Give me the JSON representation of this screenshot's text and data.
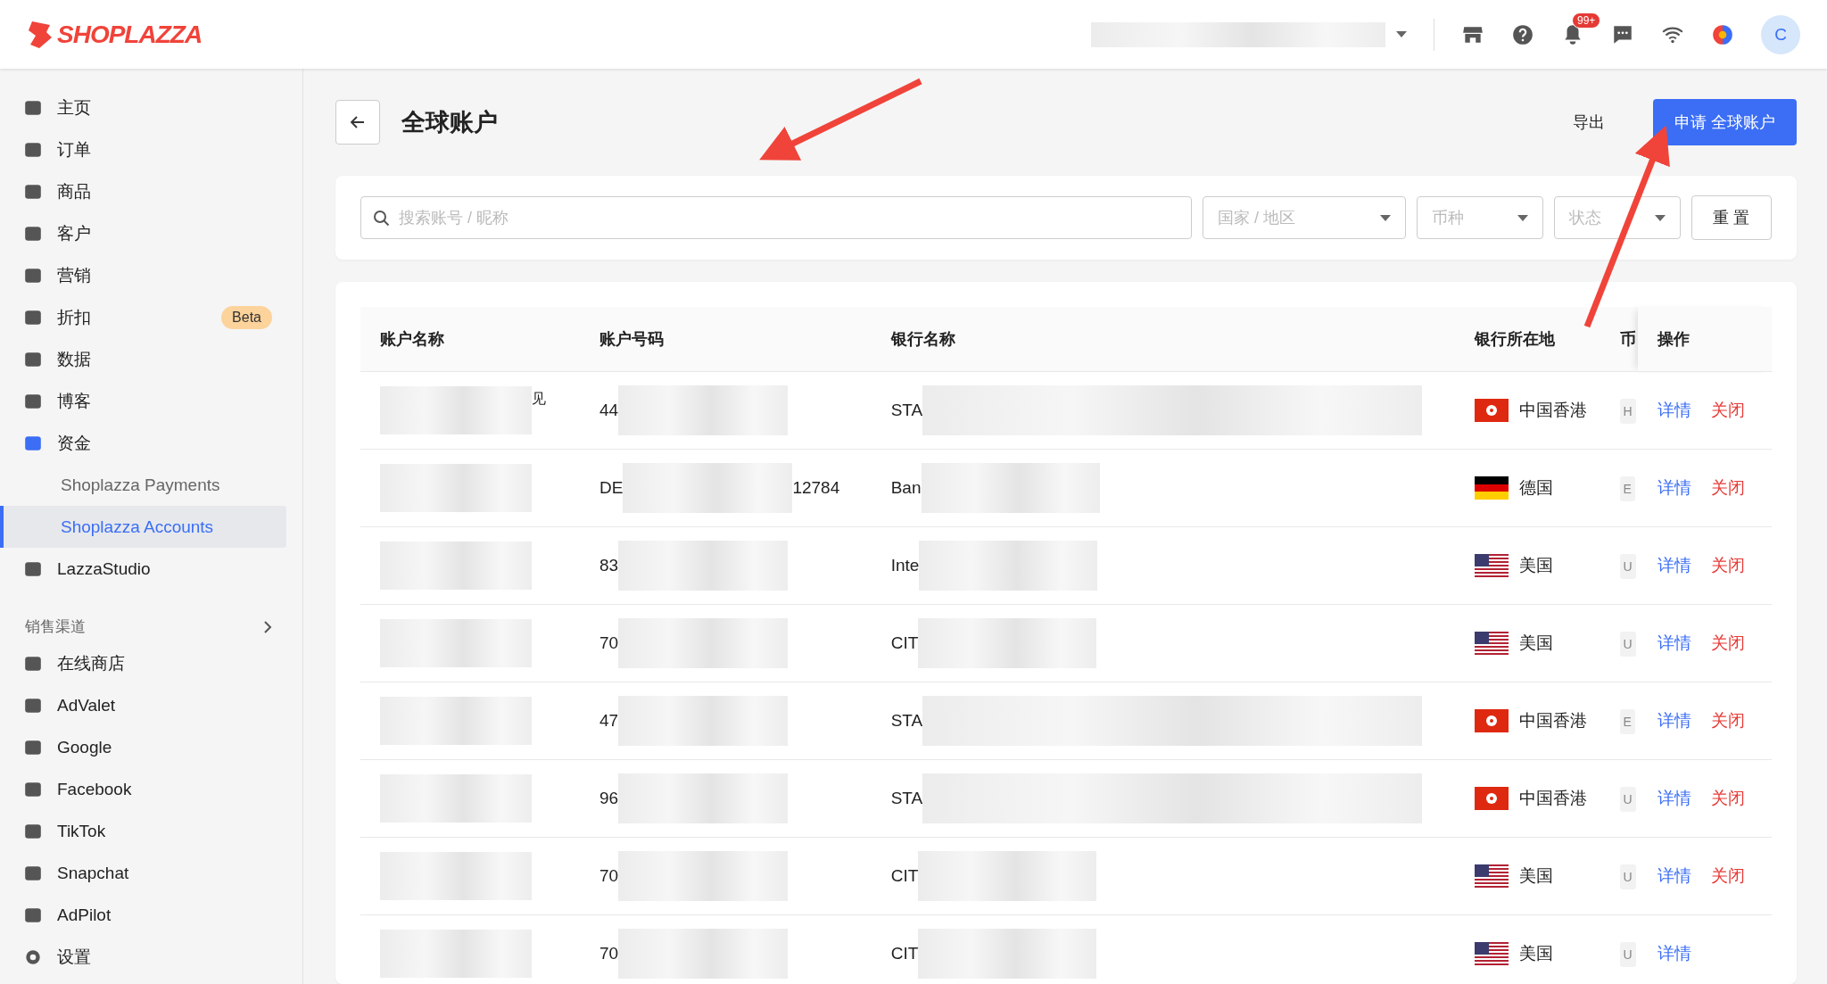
{
  "header": {
    "logo": "SHOPLAZZA",
    "notification_badge": "99+",
    "avatar": "C"
  },
  "sidebar": {
    "items": [
      {
        "label": "主页",
        "selected": false
      },
      {
        "label": "订单",
        "selected": false
      },
      {
        "label": "商品",
        "selected": false
      },
      {
        "label": "客户",
        "selected": false
      },
      {
        "label": "营销",
        "selected": false
      },
      {
        "label": "折扣",
        "selected": false,
        "badge": "Beta"
      },
      {
        "label": "数据",
        "selected": false
      },
      {
        "label": "博客",
        "selected": false
      },
      {
        "label": "资金",
        "selected": true,
        "children": [
          {
            "label": "Shoplazza Payments",
            "selected": false
          },
          {
            "label": "Shoplazza Accounts",
            "selected": true
          }
        ]
      },
      {
        "label": "LazzaStudio",
        "selected": false
      }
    ],
    "section_title": "销售渠道",
    "channels": [
      {
        "label": "在线商店"
      },
      {
        "label": "AdValet"
      },
      {
        "label": "Google"
      },
      {
        "label": "Facebook"
      },
      {
        "label": "TikTok"
      },
      {
        "label": "Snapchat"
      },
      {
        "label": "AdPilot"
      }
    ],
    "footer_item": "设置"
  },
  "page": {
    "title": "全球账户",
    "export_button": "导出",
    "apply_button": "申请 全球账户"
  },
  "filters": {
    "search": {
      "placeholder": "搜索账号 / 昵称"
    },
    "selects": [
      {
        "placeholder": "国家 / 地区"
      },
      {
        "placeholder": "币种"
      },
      {
        "placeholder": "状态"
      }
    ],
    "reset_button": "重 置"
  },
  "table": {
    "columns": [
      "账户名称",
      "账户号码",
      "银行名称",
      "银行所在地",
      "币",
      "操作"
    ],
    "rows": [
      {
        "name": "见",
        "number": "44",
        "number_extra": "",
        "bank": "STA",
        "kind": "hk",
        "location": "中国香港",
        "currency": "H",
        "actions": [
          {
            "label": "详情",
            "kind": "detail"
          },
          {
            "label": "关闭",
            "kind": "close"
          }
        ]
      },
      {
        "name": "",
        "number": "DE",
        "number_extra": "12784",
        "bank": "Ban",
        "kind": "de",
        "location": "德国",
        "currency": "E",
        "actions": [
          {
            "label": "详情",
            "kind": "detail"
          },
          {
            "label": "关闭",
            "kind": "close"
          }
        ]
      },
      {
        "name": "",
        "number": "83",
        "number_extra": "",
        "bank": "Inte",
        "kind": "us",
        "location": "美国",
        "currency": "U",
        "actions": [
          {
            "label": "详情",
            "kind": "detail"
          },
          {
            "label": "关闭",
            "kind": "close"
          }
        ]
      },
      {
        "name": "",
        "number": "70",
        "number_extra": "",
        "bank": "CIT",
        "kind": "us",
        "location": "美国",
        "currency": "U",
        "actions": [
          {
            "label": "详情",
            "kind": "detail"
          },
          {
            "label": "关闭",
            "kind": "close"
          }
        ]
      },
      {
        "name": "",
        "number": "47",
        "number_extra": "",
        "bank": "STA",
        "kind": "hk",
        "location": "中国香港",
        "currency": "E",
        "actions": [
          {
            "label": "详情",
            "kind": "detail"
          },
          {
            "label": "关闭",
            "kind": "close"
          }
        ]
      },
      {
        "name": "",
        "number": "96",
        "number_extra": "",
        "bank": "STA",
        "kind": "hk",
        "location": "中国香港",
        "currency": "U",
        "actions": [
          {
            "label": "详情",
            "kind": "detail"
          },
          {
            "label": "关闭",
            "kind": "close"
          }
        ]
      },
      {
        "name": "",
        "number": "70",
        "number_extra": "",
        "bank": "CIT",
        "kind": "us",
        "location": "美国",
        "currency": "U",
        "actions": [
          {
            "label": "详情",
            "kind": "detail"
          },
          {
            "label": "关闭",
            "kind": "close"
          }
        ]
      },
      {
        "name": "",
        "number": "70",
        "number_extra": "",
        "bank": "CIT",
        "kind": "us",
        "location": "美国",
        "currency": "U",
        "actions": [
          {
            "label": "详情",
            "kind": "detail"
          }
        ]
      }
    ]
  }
}
